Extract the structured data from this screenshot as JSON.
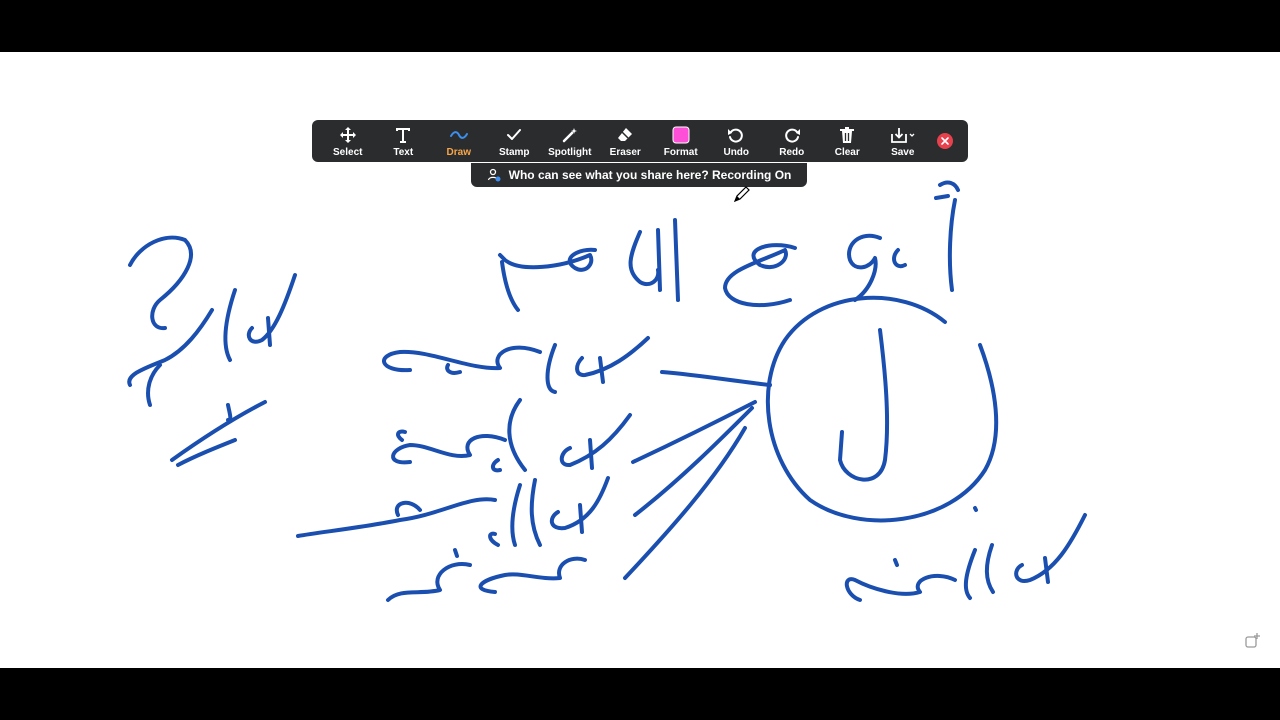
{
  "toolbar": {
    "tools": [
      {
        "label": "Select",
        "icon": "move-icon"
      },
      {
        "label": "Text",
        "icon": "text-icon"
      },
      {
        "label": "Draw",
        "icon": "squiggle-icon",
        "active": true
      },
      {
        "label": "Stamp",
        "icon": "checkmark-icon"
      },
      {
        "label": "Spotlight",
        "icon": "magic-wand-icon"
      },
      {
        "label": "Eraser",
        "icon": "eraser-icon"
      },
      {
        "label": "Format",
        "icon": "color-swatch-icon",
        "swatch_color": "#ff4fd8"
      },
      {
        "label": "Undo",
        "icon": "undo-icon"
      },
      {
        "label": "Redo",
        "icon": "redo-icon"
      },
      {
        "label": "Clear",
        "icon": "trash-icon"
      },
      {
        "label": "Save",
        "icon": "save-icon"
      }
    ],
    "close_icon": "close-icon",
    "active_color": "#f7a64a",
    "close_color": "#e8414e"
  },
  "banner": {
    "text": "Who can see what you share here? Recording On",
    "icon": "person-lock-icon"
  },
  "whiteboard": {
    "ink_color": "#1a4fb0",
    "handwritten_labels": [
      "أنواع اللام",
      "لام التعليل",
      "لام الجحود",
      "لام الأمر",
      "حرف جر",
      "لام التوكيد",
      "لام القسم",
      "ل"
    ]
  }
}
